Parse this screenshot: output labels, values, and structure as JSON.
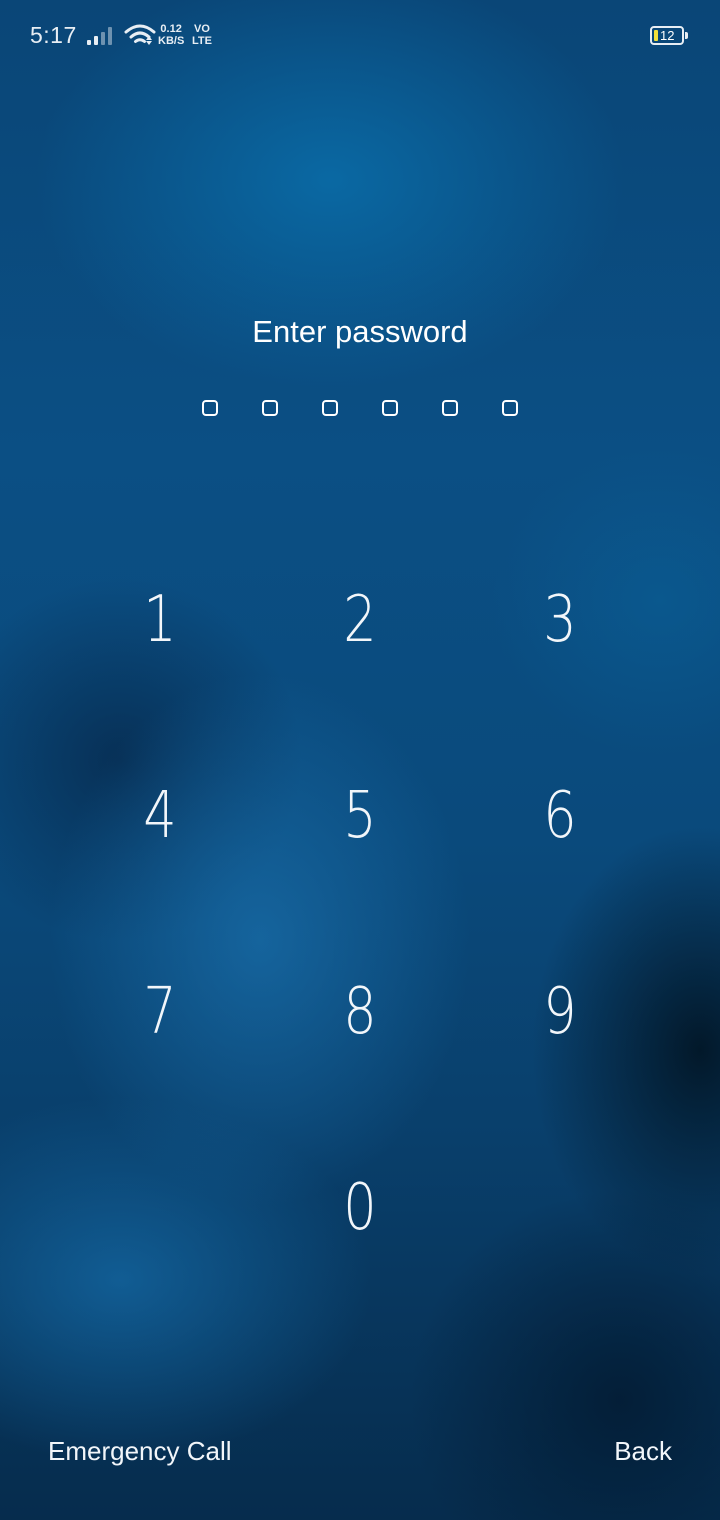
{
  "status_bar": {
    "time": "5:17",
    "net_speed_value": "0.12",
    "net_speed_unit": "KB/S",
    "volte_top": "VO",
    "volte_bottom": "LTE",
    "battery_level": "12",
    "signal_icon": "signal-bars-icon",
    "wifi_icon": "wifi-icon"
  },
  "lock": {
    "title": "Enter password",
    "pin_length": 6,
    "pin_entered": 0
  },
  "keypad": {
    "keys": [
      "1",
      "2",
      "3",
      "4",
      "5",
      "6",
      "7",
      "8",
      "9",
      "0"
    ]
  },
  "actions": {
    "emergency_label": "Emergency Call",
    "back_label": "Back"
  },
  "colors": {
    "text": "#ffffff",
    "battery_fill": "#f3e13a",
    "background_primary": "#0b4f84",
    "background_dark": "#062c4d"
  }
}
